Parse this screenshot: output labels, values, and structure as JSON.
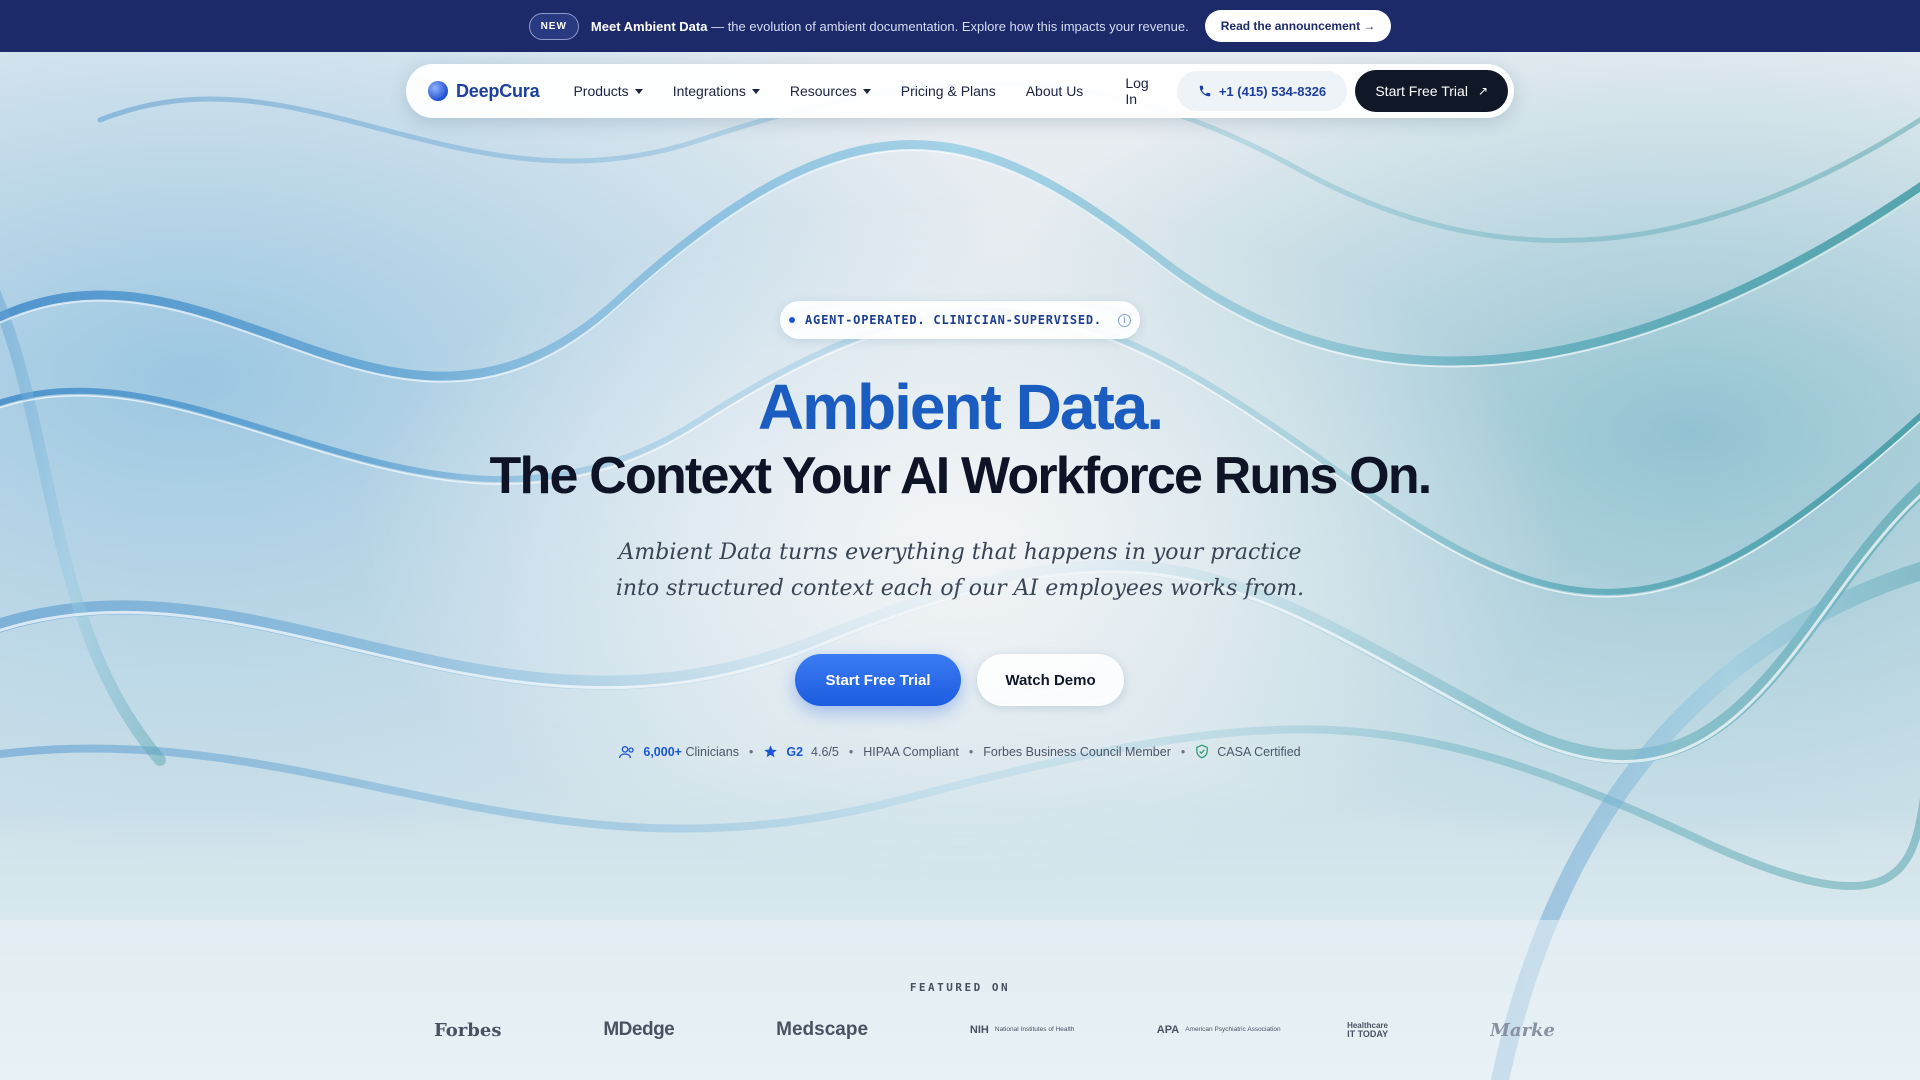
{
  "banner": {
    "badge": "NEW",
    "headline": "Meet Ambient Data",
    "message": " — the evolution of ambient documentation. Explore how this impacts your revenue.",
    "cta": "Read the announcement →"
  },
  "nav": {
    "brand": "DeepCura",
    "items": [
      {
        "label": "Products",
        "dropdown": true
      },
      {
        "label": "Integrations",
        "dropdown": true
      },
      {
        "label": "Resources",
        "dropdown": true
      },
      {
        "label": "Pricing & Plans",
        "dropdown": false
      },
      {
        "label": "About Us",
        "dropdown": false
      }
    ],
    "login": "Log In",
    "phone": "+1 (415) 534-8326",
    "trial": "Start Free Trial"
  },
  "hero": {
    "eyebrow": "AGENT-OPERATED. CLINICIAN-SUPERVISED.",
    "title_line1": "Ambient Data.",
    "title_line2": "The Context Your AI Workforce Runs On.",
    "subtitle_line1": "Ambient Data turns everything that happens in your practice",
    "subtitle_line2": "into structured context each of our AI employees works from.",
    "primary_cta": "Start Free Trial",
    "secondary_cta": "Watch Demo"
  },
  "trust": {
    "clinicians_count": "6,000+",
    "clinicians_label": "Clinicians",
    "g2_label": "G2",
    "g2_rating": "4.6/5",
    "hipaa": "HIPAA Compliant",
    "forbes": "Forbes Business Council Member",
    "casa": "CASA Certified"
  },
  "featured": {
    "label": "FEATURED ON",
    "logos": {
      "forbes": "Forbes",
      "mdedge": "MDedge",
      "medscape": "Medscape",
      "nih_mark": "NIH",
      "nih_desc": "National Institutes of Health",
      "apa_mark": "APA",
      "apa_desc": "American Psychiatric Association",
      "hit_line1": "Healthcare",
      "hit_line2": "IT TODAY",
      "market": "Market"
    }
  },
  "colors": {
    "banner_bg": "#1c2a6a",
    "accent_blue": "#1b5cc0",
    "primary_button": "#1d5ce0",
    "dark_button": "#101828"
  }
}
